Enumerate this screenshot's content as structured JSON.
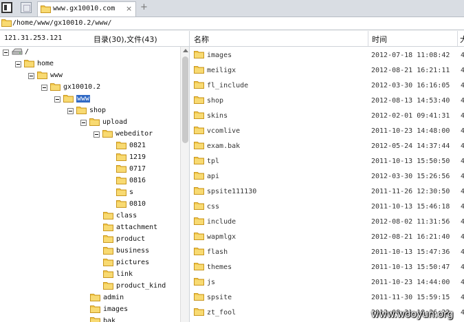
{
  "tab": {
    "title": "www.gx10010.com",
    "close": "×",
    "add": "+"
  },
  "address": {
    "path": "/home/www/gx10010.2/www/"
  },
  "left_info": {
    "ip": "121.31.253.121",
    "counts": "目录(30),文件(43)"
  },
  "tree": [
    {
      "label": "/",
      "icon": "drive-icon"
    },
    {
      "label": "home"
    },
    {
      "label": "www"
    },
    {
      "label": "gx10010.2"
    },
    {
      "label": "www",
      "selected": true
    },
    {
      "label": "shop"
    },
    {
      "label": "upload"
    },
    {
      "label": "webeditor"
    },
    {
      "label": "0821"
    },
    {
      "label": "1219"
    },
    {
      "label": "0717"
    },
    {
      "label": "0816"
    },
    {
      "label": "s"
    },
    {
      "label": "0810"
    },
    {
      "label": "class"
    },
    {
      "label": "attachment"
    },
    {
      "label": "product"
    },
    {
      "label": "business"
    },
    {
      "label": "pictures"
    },
    {
      "label": "link"
    },
    {
      "label": "product_kind"
    },
    {
      "label": "admin"
    },
    {
      "label": "images"
    },
    {
      "label": "bak"
    }
  ],
  "list_header": {
    "name": "名称",
    "time": "时间",
    "size": "大"
  },
  "files": [
    {
      "name": "images",
      "time": "2012-07-18 11:08:42",
      "size": "4"
    },
    {
      "name": "meiligx",
      "time": "2012-08-21 16:21:11",
      "size": "4"
    },
    {
      "name": "fl_include",
      "time": "2012-03-30 16:16:05",
      "size": "4"
    },
    {
      "name": "shop",
      "time": "2012-08-13 14:53:40",
      "size": "4"
    },
    {
      "name": "skins",
      "time": "2012-02-01 09:41:31",
      "size": "4"
    },
    {
      "name": "vcomlive",
      "time": "2011-10-23 14:48:00",
      "size": "4"
    },
    {
      "name": "exam.bak",
      "time": "2012-05-24 14:37:44",
      "size": "4"
    },
    {
      "name": "tpl",
      "time": "2011-10-13 15:50:50",
      "size": "4"
    },
    {
      "name": "api",
      "time": "2012-03-30 15:26:56",
      "size": "4"
    },
    {
      "name": "spsite111130",
      "time": "2011-11-26 12:30:50",
      "size": "4"
    },
    {
      "name": "css",
      "time": "2011-10-13 15:46:18",
      "size": "4"
    },
    {
      "name": "include",
      "time": "2012-08-02 11:31:56",
      "size": "4"
    },
    {
      "name": "wapmlgx",
      "time": "2012-08-21 16:21:40",
      "size": "4"
    },
    {
      "name": "flash",
      "time": "2011-10-13 15:47:36",
      "size": "4"
    },
    {
      "name": "themes",
      "time": "2011-10-13 15:50:47",
      "size": "4"
    },
    {
      "name": "js",
      "time": "2011-10-23 14:44:00",
      "size": "4"
    },
    {
      "name": "spsite",
      "time": "2011-11-30 15:59:15",
      "size": "4"
    },
    {
      "name": "zt_fool",
      "time": "2012-08-31 18:26:22",
      "size": "4"
    }
  ],
  "watermark": "www.wooyun.org",
  "colors": {
    "selection": "#316ac5",
    "folder": "#f3c94d",
    "tabbar": "#d9dde3"
  }
}
